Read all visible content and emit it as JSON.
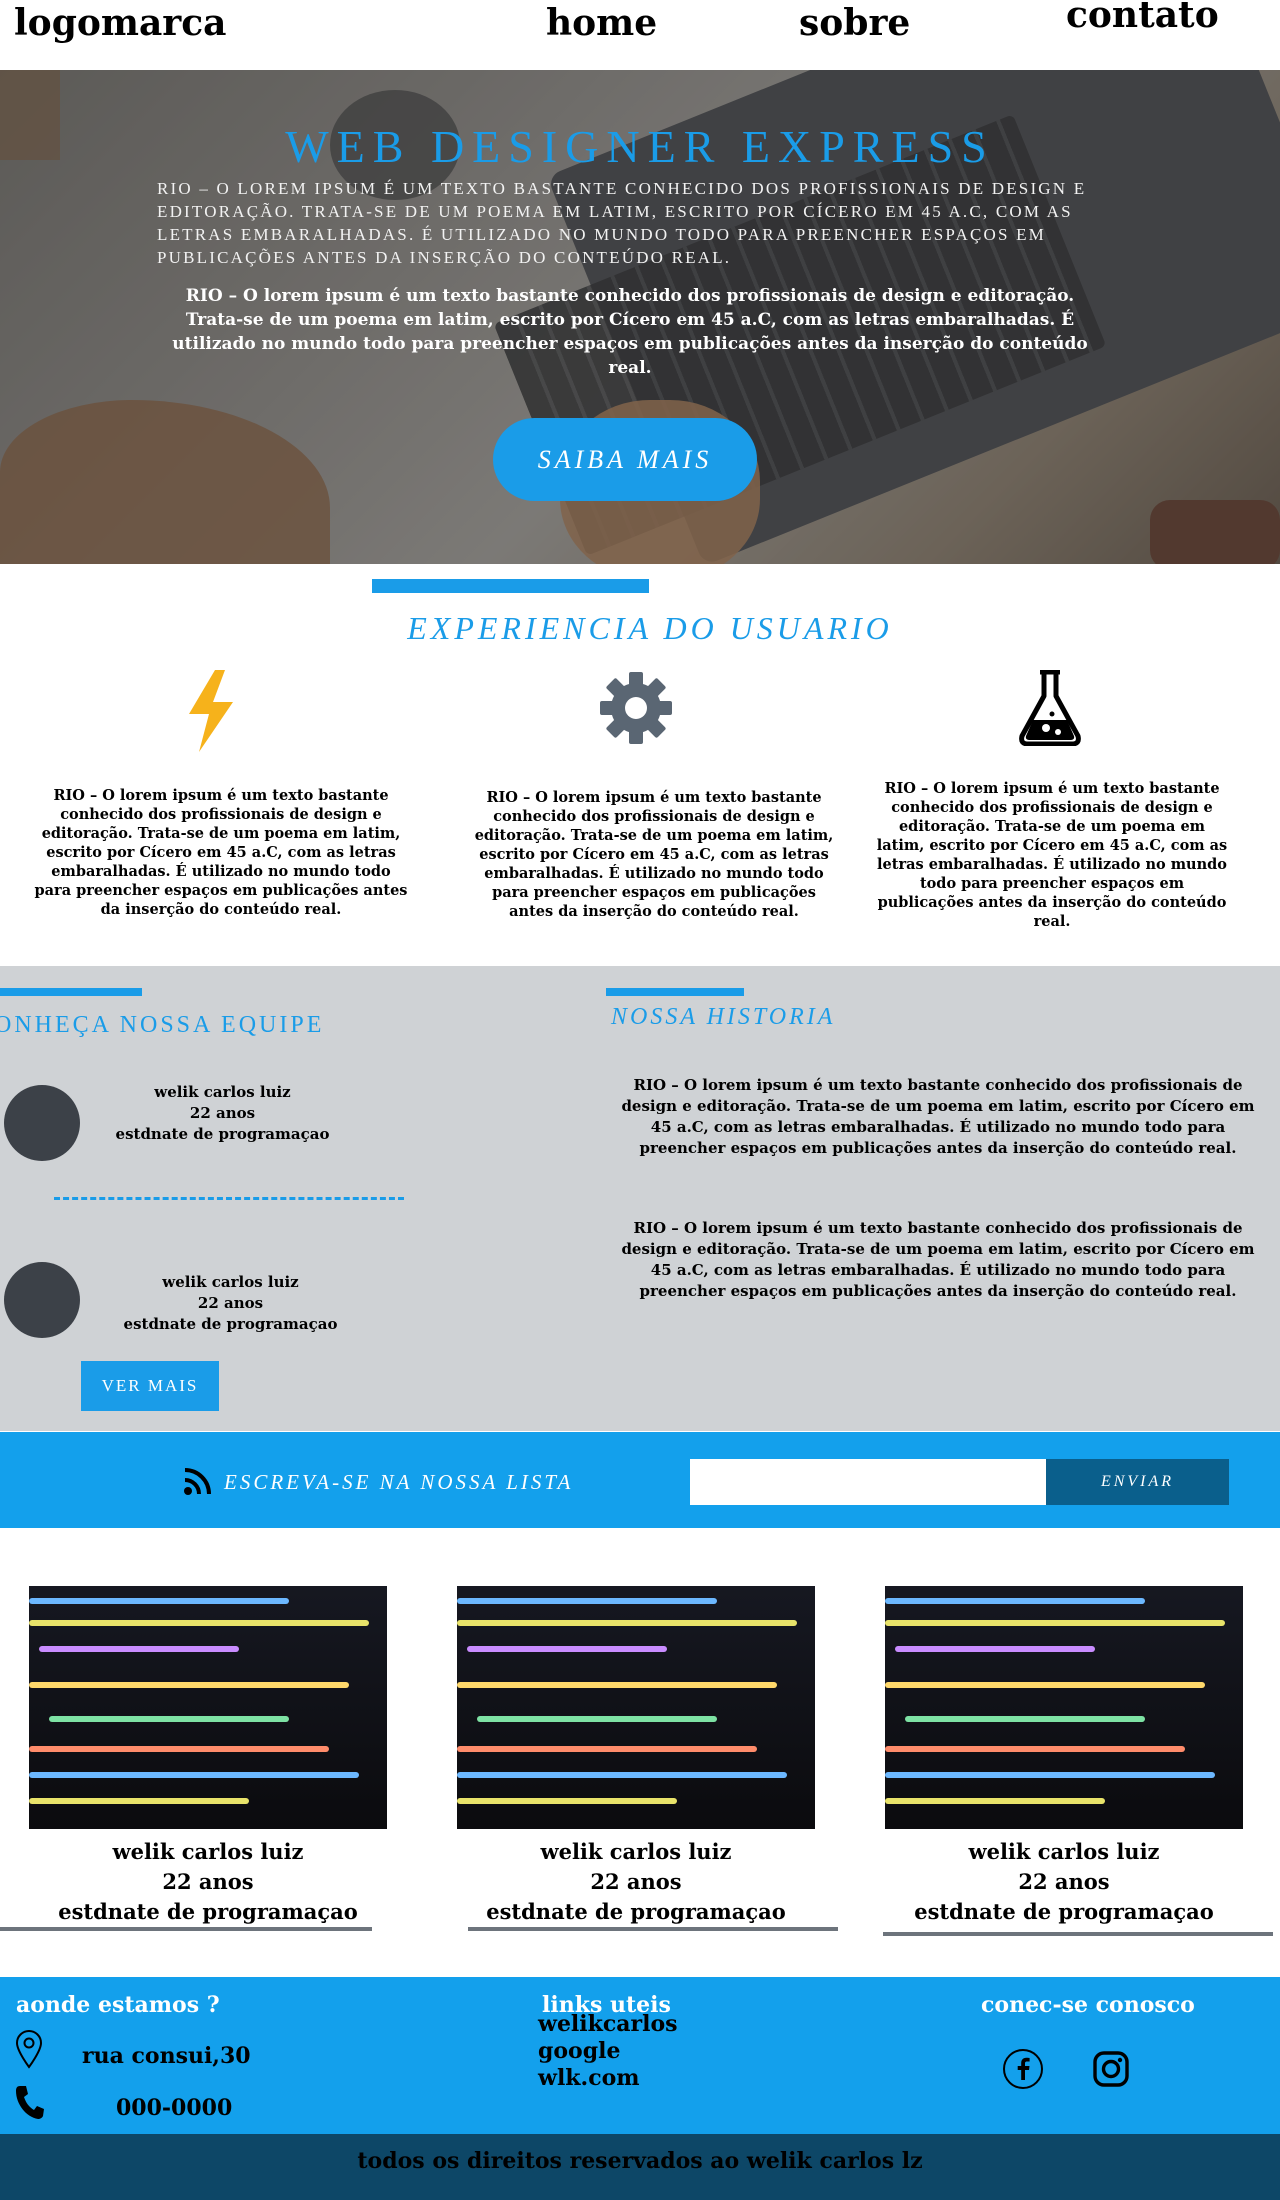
{
  "header": {
    "logo": "logomarca",
    "nav": {
      "home": "home",
      "about": "sobre",
      "contact": "contato"
    }
  },
  "hero": {
    "title": "WEB DESIGNER EXPRESS",
    "caps_text": "RIO – O LOREM IPSUM É UM TEXTO BASTANTE CONHECIDO DOS PROFISSIONAIS DE DESIGN E EDITORAÇÃO. TRATA-SE DE UM POEMA EM LATIM, ESCRITO POR CÍCERO EM 45 A.C, COM AS LETRAS EMBARALHADAS. É UTILIZADO NO MUNDO TODO PARA PREENCHER ESPAÇOS EM PUBLICAÇÕES ANTES DA INSERÇÃO DO CONTEÚDO REAL.",
    "bold_text": "RIO – O lorem ipsum é um texto bastante conhecido dos profissionais de design e editoração. Trata-se de um poema em latim, escrito por Cícero em 45 a.C, com as letras embaralhadas. É utilizado no mundo todo para preencher espaços em publicações antes da inserção do conteúdo real.",
    "button": "SAIBA MAIS"
  },
  "experience": {
    "title": "EXPERIENCIA DO USUARIO",
    "items": [
      {
        "icon": "lightning-icon",
        "color": "#f6b21b",
        "text": "RIO – O lorem ipsum é um texto bastante conhecido dos profissionais de design e editoração. Trata-se de um poema em latim, escrito por Cícero em 45 a.C, com as letras embaralhadas. É utilizado no mundo todo para preencher espaços em publicações antes da inserção do conteúdo real."
      },
      {
        "icon": "gear-icon",
        "color": "#5a6673",
        "text": "RIO – O lorem ipsum é um texto bastante conhecido dos profissionais de design e editoração. Trata-se de um poema em latim, escrito por Cícero em 45 a.C, com as letras embaralhadas. É utilizado no mundo todo para preencher espaços em publicações antes da inserção do conteúdo real."
      },
      {
        "icon": "flask-icon",
        "color": "#000000",
        "text": "RIO – O lorem ipsum é um texto bastante conhecido dos profissionais de design e editoração. Trata-se de um poema em latim, escrito por Cícero em 45 a.C, com as letras embaralhadas. É utilizado no mundo todo para preencher espaços em publicações antes da inserção do conteúdo real."
      }
    ]
  },
  "team": {
    "title": "ONHEÇA NOSSA EQUIPE",
    "members": [
      {
        "name": "welik carlos luiz",
        "age": "22 anos",
        "role": "estdnate de programaçao"
      },
      {
        "name": "welik carlos luiz",
        "age": "22 anos",
        "role": "estdnate de programaçao"
      }
    ],
    "button": "VER MAIS"
  },
  "history": {
    "title": "NOSSA HISTORIA",
    "paragraphs": [
      "RIO – O lorem ipsum é um texto bastante conhecido dos profissionais de design e editoração. Trata-se de um poema em latim, escrito por Cícero em 45 a.C, com as letras embaralhadas. É utilizado no mundo todo para preencher espaços em publicações antes da inserção do conteúdo real.",
      "RIO – O lorem ipsum é um texto bastante conhecido dos profissionais de design e editoração. Trata-se de um poema em latim, escrito por Cícero em 45 a.C, com as letras embaralhadas. É utilizado no mundo todo para preencher espaços em publicações antes da inserção do conteúdo real."
    ]
  },
  "subscribe": {
    "icon": "rss-icon",
    "label": "ESCREVA-SE NA NOSSA LISTA",
    "input_value": "",
    "button": "ENVIAR"
  },
  "cards": [
    {
      "name": "welik carlos luiz",
      "age": "22 anos",
      "role": "estdnate de programaçao"
    },
    {
      "name": "welik carlos luiz",
      "age": "22 anos",
      "role": "estdnate de programaçao"
    },
    {
      "name": "welik carlos luiz",
      "age": "22 anos",
      "role": "estdnate de programaçao"
    }
  ],
  "footer": {
    "location_title": "aonde estamos ?",
    "address": "rua consui,30",
    "phone": "000-0000",
    "links_title": "links uteis",
    "links": [
      "welikcarlos",
      "google",
      "wlk.com"
    ],
    "social_title": "conec-se conosco",
    "social_icons": [
      "facebook-icon",
      "instagram-icon"
    ],
    "copyright": "todos os direitos reservados ao welik carlos lz"
  },
  "colors": {
    "accent": "#1a9ce8",
    "grey_section": "#cfd2d5",
    "dark_blue": "#0d4767"
  }
}
